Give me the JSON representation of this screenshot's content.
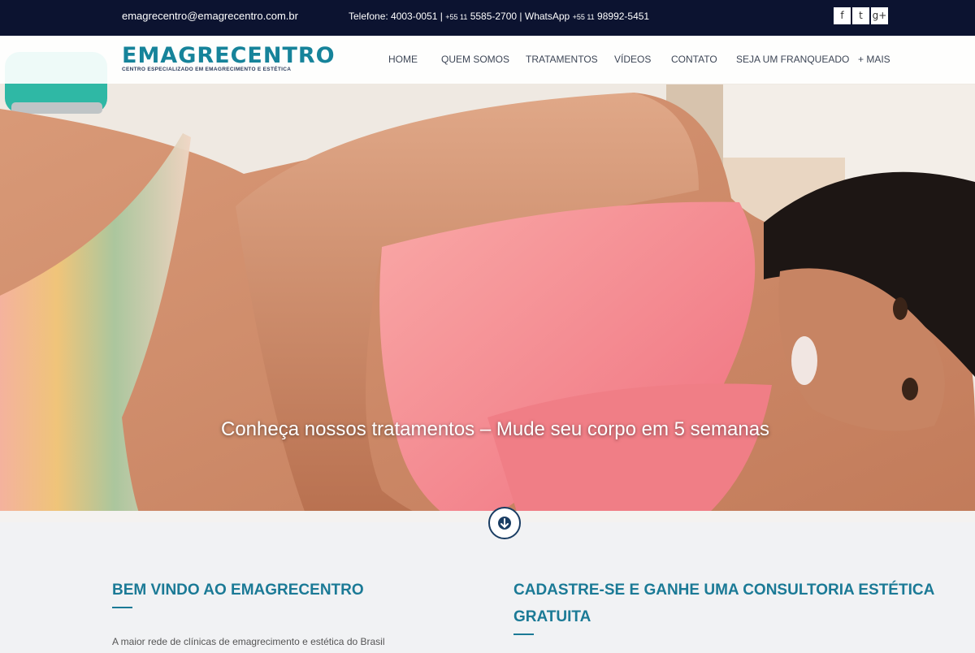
{
  "topbar": {
    "email": "emagrecentro@emagrecentro.com.br",
    "phone_label": "Telefone: 4003-0051 |",
    "phone2_prefix": "+55 11",
    "phone2": "5585-2700 |",
    "whatsapp_label": "WhatsApp",
    "whatsapp_prefix": "+55 11",
    "whatsapp": "98992-5451",
    "social": [
      {
        "icon": "facebook-icon",
        "glyph": "f"
      },
      {
        "icon": "twitter-icon",
        "glyph": "t"
      },
      {
        "icon": "google-plus-icon",
        "glyph": "g+"
      }
    ]
  },
  "logo": {
    "name": "EMAGRECENTRO",
    "tagline": "CENTRO ESPECIALIZADO EM EMAGRECIMENTO E ESTÉTICA"
  },
  "nav": {
    "items": [
      "HOME",
      "QUEM SOMOS",
      "TRATAMENTOS",
      "VÍDEOS",
      "CONTATO",
      "SEJA UM FRANQUEADO",
      "+ MAIS"
    ]
  },
  "hero": {
    "caption": "Conheça nossos tratamentos – Mude seu corpo em 5 semanas"
  },
  "content": {
    "welcome_title": "BEM VINDO AO EMAGRECENTRO",
    "welcome_text": "A maior rede de clínicas de emagrecimento e estética do Brasil",
    "signup_title_line1": "CADASTRE-SE E GANHE UMA CONSULTORIA ESTÉTICA",
    "signup_title_line2": "GRATUITA"
  },
  "colors": {
    "topbar_bg": "#0c1330",
    "accent": "#1b7a96",
    "nav_text": "#3d4656"
  }
}
